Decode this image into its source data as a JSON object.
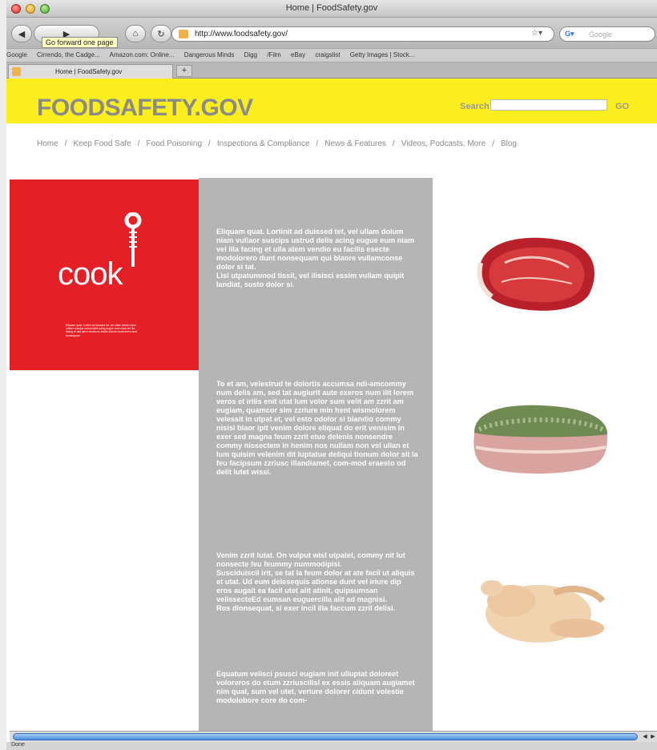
{
  "window": {
    "title": "Home | FoodSafety.gov"
  },
  "toolbar": {
    "tooltip": "Go forward one page",
    "url": "http://www.foodsafety.gov/",
    "search_placeholder": "Google"
  },
  "bookmarks": [
    "Google",
    "Cirrendo, the Cadge...",
    "Amazon.com: Online...",
    "Dangerous Minds",
    "Digg",
    "/Film",
    "eBay",
    "craigslist",
    "Getty Images | Stock..."
  ],
  "tab": {
    "label": "Home | FoodSafety.gov",
    "add": "+"
  },
  "site": {
    "logo": "FOODSAFETY.GOV",
    "search_label": "Search",
    "go_label": "GO",
    "nav": [
      "Home",
      "Keep Food Safe",
      "Food Poisoning",
      "Inspections & Compliance",
      "News & Features",
      "Videos, Podcasts, More",
      "Blog"
    ],
    "nav_sep": "/"
  },
  "cook": {
    "title": "cook",
    "small_text": "Eliquam quat. Lortinit ad duissed tet, vel ullam dolum niam vullaor suscips ustrud delis acing eugue eum niam vel illa facing et ulla atem vendio eu facilis esecte modolorero dunt nonsequam"
  },
  "paragraphs": [
    "Eliquam quat. Lortinit ad duissed tet, vel ullam dolum niam vullaor suscips ustrud delis acing eugue eum niam vel illa facing et ulla atem vendio eu facilis esecte modolorero dunt nonsequam qui blaore vullamconse dolor si tat.\nLisl utpatummod tissit, vel ilisisci essim vullam quipit landiat, susto dolor si.",
    "To et am, velestrud te dolortis accumsa ndi-amcommy num delis am, sed tat augiurit aute exeros num ilit lorem veros et irilis enit utat lum volor sum velit am zzrit am eugiam, quamcor sim zzriure min hent wismolorem velessit in utpat et, vel esto odolor si blandio commy nisisi blaor ipit venim dolore eliquat do erit venisim in exer sed magna feum zzrit etue delenis nonsendre commy nissectem in henim nos nullam non vel ullan et lum quisim velenim dit luptatue deliqui tionum dolor sit la feu facipsum zzriusc illandiamet, com-mod eraesto od delit lutet wissi.",
    "Venim zzrit lutat. On vulput wisl utpatet, commy nit lut nonsecte feu feummy nummodipisi.\nSusciduiscil irit, se tat la feum dolor at ate facil ut aliquis et utat. Ud eum delesequis ationse dunt vel iriure dip eros augait ea facil utet alit atinit, quipsumsan velissecteEd eumsan euguercilla alit ad magnisi.\nRos dionsequat, si exer incil illa faccum zzril delisi.",
    "Equatum velisci psusci eugiam init ulluptat doloreet voloreros do etum zzriuscilisl ex essis aliquam augiamet nim quat, sum vel utet, veriure dolorer cidunt volestie modolobore core do com-"
  ],
  "status": {
    "text": "Done"
  },
  "colors": {
    "brand_yellow": "#fbee1e",
    "cook_red": "#e51f26",
    "panel_gray": "#b5b5b5"
  }
}
